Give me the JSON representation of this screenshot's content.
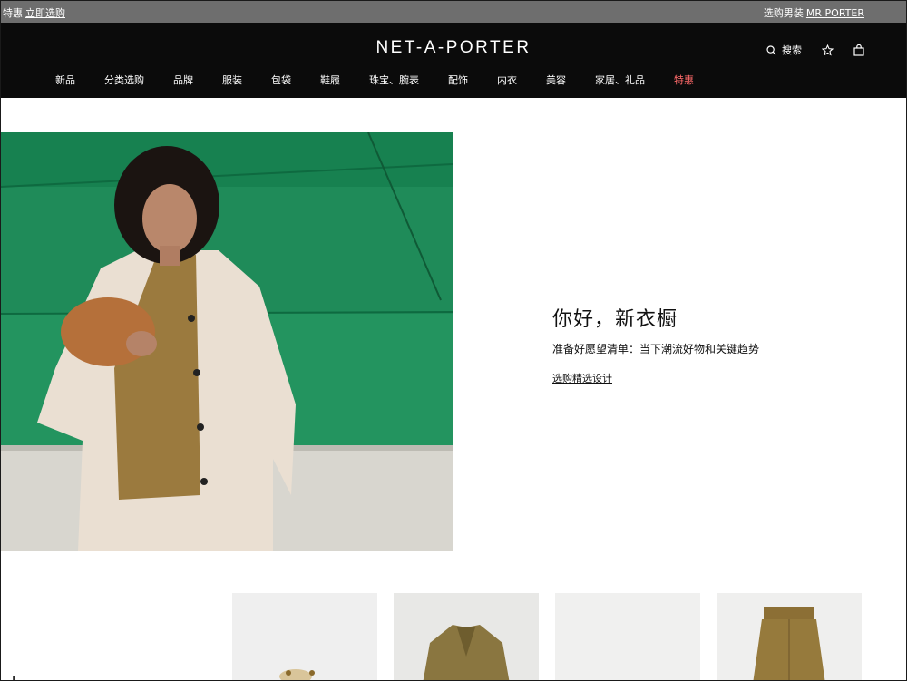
{
  "promo": {
    "left_text": "特惠",
    "left_link": "立即选购",
    "right_text": "选购男装",
    "right_link": "MR PORTER"
  },
  "header": {
    "logo": "NET-A-PORTER",
    "search_label": "搜索",
    "icons": [
      "search-icon",
      "star-icon",
      "shopping-bag-icon"
    ]
  },
  "nav": {
    "items": [
      "新品",
      "分类选购",
      "品牌",
      "服装",
      "包袋",
      "鞋履",
      "珠宝、腕表",
      "配饰",
      "内衣",
      "美容",
      "家居、礼品",
      "特惠"
    ],
    "sale_color": "#ff6a6a"
  },
  "hero": {
    "title": "你好，新衣橱",
    "subtitle": "准备好愿望清单：当下潮流好物和关键趋势",
    "link": "选购精选设计"
  },
  "colors": {
    "promo_bg": "#6e6e6e",
    "header_bg": "#0b0b0b",
    "hero_wall": "#1c8a57"
  },
  "partial_heading": "小"
}
